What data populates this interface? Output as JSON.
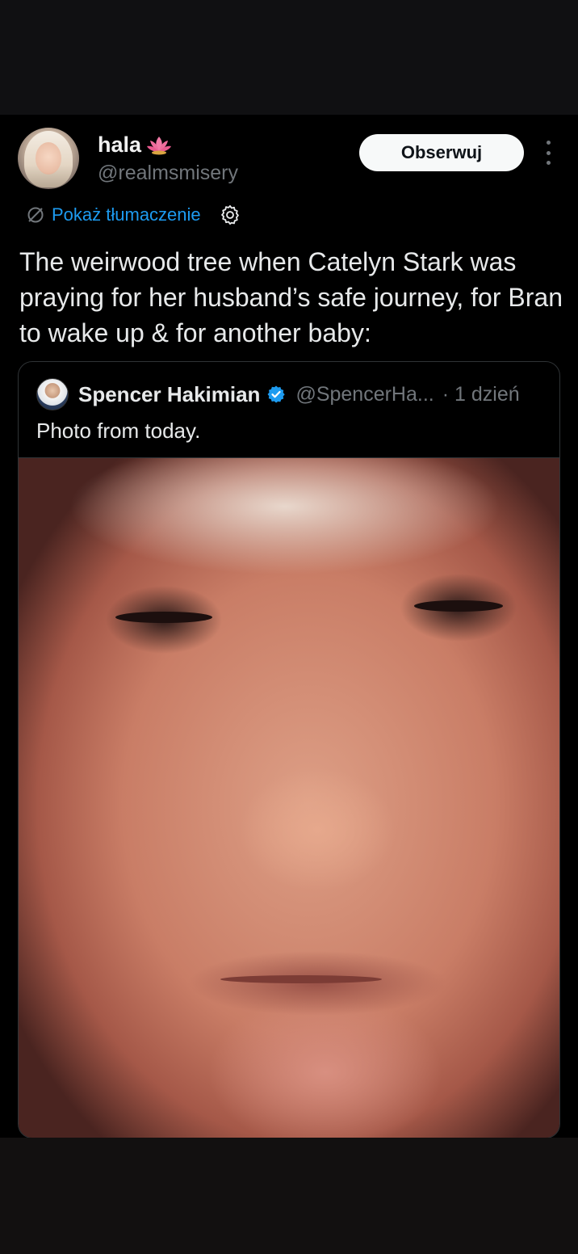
{
  "post": {
    "display_name": "hala",
    "name_emoji": "lotus",
    "handle": "@realmsmisery",
    "follow_label": "Obserwuj",
    "translate_label": "Pokaż tłumaczenie",
    "text": "The weirwood tree when Catelyn Stark was praying for her husband’s safe journey, for Bran to wake up & for another baby:"
  },
  "quote": {
    "name": "Spencer Hakimian",
    "handle": "@SpencerHa...",
    "time": "· 1 dzień",
    "text": "Photo from today."
  },
  "colors": {
    "link": "#1d9bf0",
    "verified": "#1d9bf0",
    "muted": "#71767b",
    "background": "#000000"
  }
}
